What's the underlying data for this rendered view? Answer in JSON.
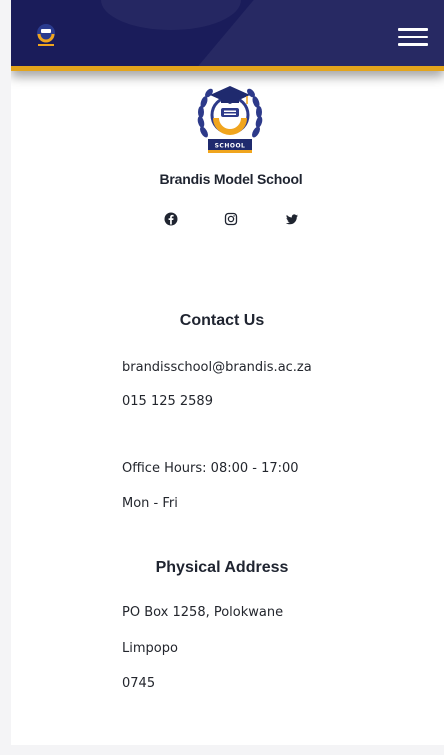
{
  "navbar": {
    "menu_icon": "hamburger-menu-icon",
    "logo_icon": "school-logo-icon",
    "colors": {
      "background": "#1a1c5a",
      "accent": "#e3a41c"
    }
  },
  "brand": {
    "logo_text": "SCHOOL",
    "name": "Brandis Model School"
  },
  "social": [
    "facebook-icon",
    "instagram-icon",
    "twitter-icon"
  ],
  "contact": {
    "heading": "Contact Us",
    "email": "brandisschool@brandis.ac.za",
    "phone": "015 125 2589",
    "office_hours": "Office Hours: 08:00 - 17:00",
    "days": "Mon - Fri"
  },
  "address": {
    "heading": "Physical Address",
    "line1": "PO Box 1258, Polokwane",
    "line2": "Limpopo",
    "line3": "0745"
  }
}
